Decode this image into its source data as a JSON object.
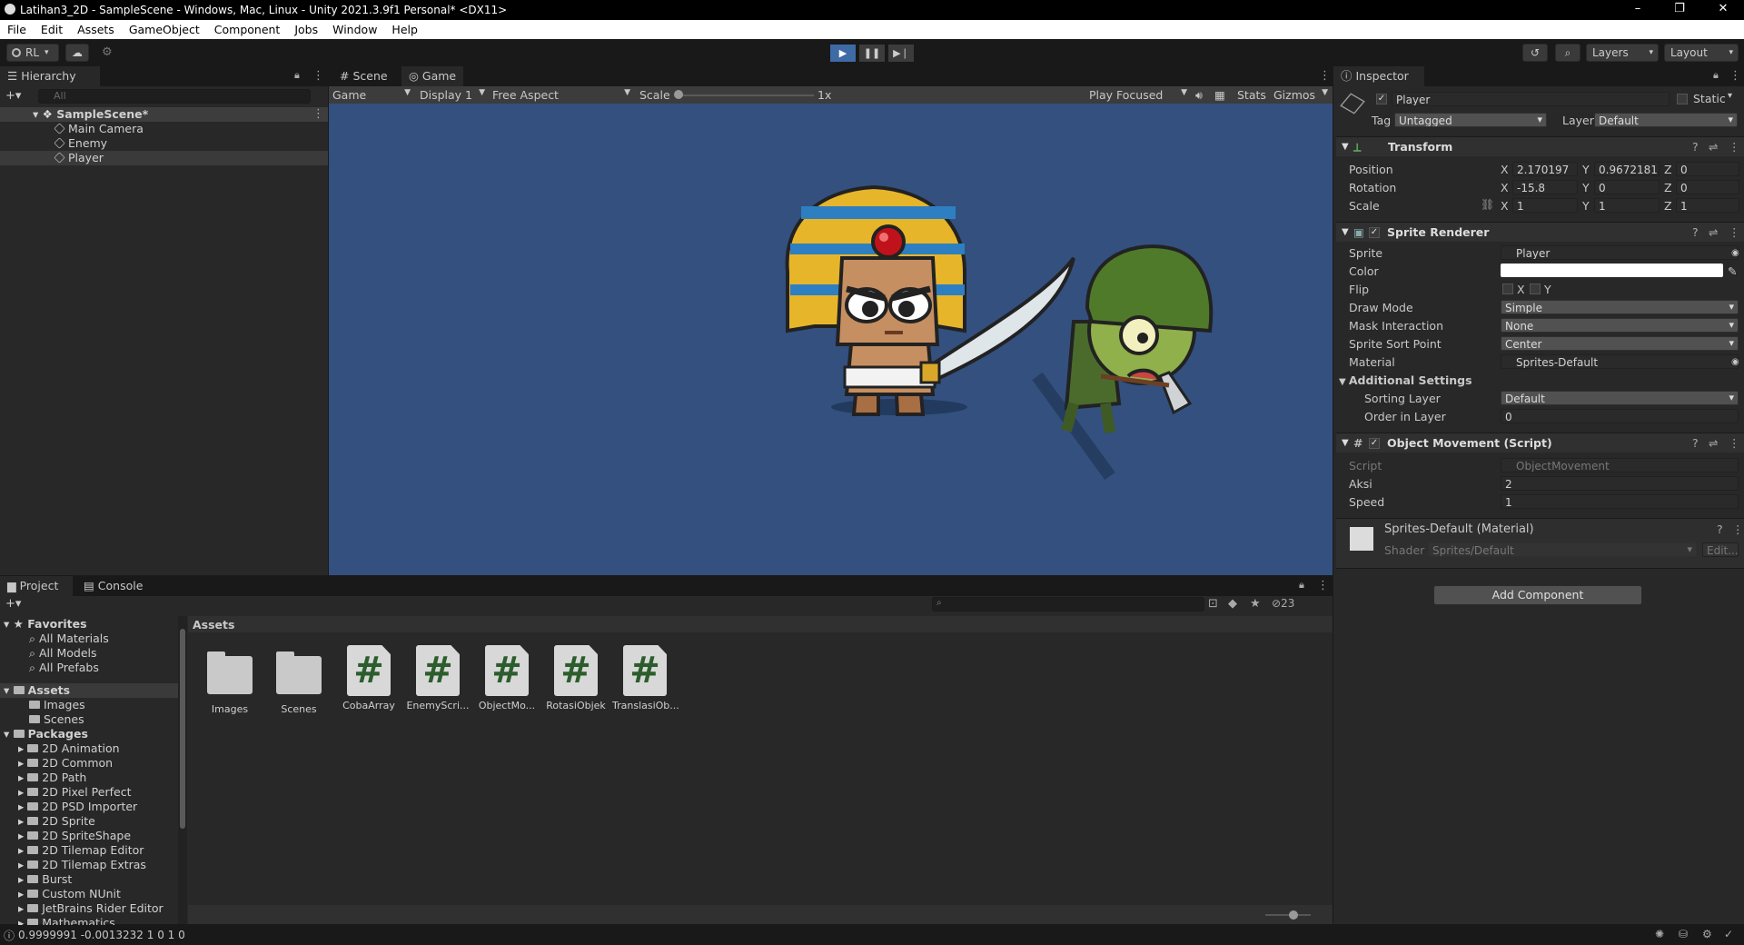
{
  "window": {
    "title": "Latihan3_2D - SampleScene - Windows, Mac, Linux - Unity 2021.3.9f1 Personal* <DX11>"
  },
  "menu": [
    "File",
    "Edit",
    "Assets",
    "GameObject",
    "Component",
    "Jobs",
    "Window",
    "Help"
  ],
  "toolbar": {
    "account": "RL",
    "layers": "Layers",
    "layout": "Layout"
  },
  "hierarchy": {
    "tab": "Hierarchy",
    "search_placeholder": "All",
    "scene": "SampleScene*",
    "items": [
      "Main Camera",
      "Enemy",
      "Player"
    ]
  },
  "viewport": {
    "tabs": [
      "Scene",
      "Game"
    ],
    "game_dropdown": "Game",
    "display": "Display 1",
    "aspect": "Free Aspect",
    "scale_label": "Scale",
    "scale_value": "1x",
    "play_focused": "Play Focused",
    "stats": "Stats",
    "gizmos": "Gizmos",
    "background": "#33507f"
  },
  "inspector": {
    "tab": "Inspector",
    "object_name": "Player",
    "static_label": "Static",
    "tag_label": "Tag",
    "tag_value": "Untagged",
    "layer_label": "Layer",
    "layer_value": "Default",
    "transform": {
      "header": "Transform",
      "position_label": "Position",
      "rotation_label": "Rotation",
      "scale_label": "Scale",
      "position": {
        "x": "2.170197",
        "y": "0.9672181",
        "z": "0"
      },
      "rotation": {
        "x": "-15.8",
        "y": "0",
        "z": "0"
      },
      "scale": {
        "x": "1",
        "y": "1",
        "z": "1"
      }
    },
    "sprite_renderer": {
      "header": "Sprite Renderer",
      "sprite_label": "Sprite",
      "sprite_value": "Player",
      "color_label": "Color",
      "flip_label": "Flip",
      "flip_x": "X",
      "flip_y": "Y",
      "draw_mode_label": "Draw Mode",
      "draw_mode_value": "Simple",
      "mask_label": "Mask Interaction",
      "mask_value": "None",
      "sort_point_label": "Sprite Sort Point",
      "sort_point_value": "Center",
      "material_label": "Material",
      "material_value": "Sprites-Default",
      "additional_label": "Additional Settings",
      "sorting_layer_label": "Sorting Layer",
      "sorting_layer_value": "Default",
      "order_label": "Order in Layer",
      "order_value": "0"
    },
    "object_movement": {
      "header": "Object Movement (Script)",
      "script_label": "Script",
      "script_value": "ObjectMovement",
      "aksi_label": "Aksi",
      "aksi_value": "2",
      "speed_label": "Speed",
      "speed_value": "1"
    },
    "material": {
      "name": "Sprites-Default (Material)",
      "shader_label": "Shader",
      "shader_value": "Sprites/Default",
      "edit": "Edit..."
    },
    "add_component": "Add Component"
  },
  "project": {
    "tabs": [
      "Project",
      "Console"
    ],
    "hidden_count": "23",
    "favorites_label": "Favorites",
    "favorites": [
      "All Materials",
      "All Models",
      "All Prefabs"
    ],
    "assets_label": "Assets",
    "asset_folders": [
      "Images",
      "Scenes"
    ],
    "packages_label": "Packages",
    "packages": [
      "2D Animation",
      "2D Common",
      "2D Path",
      "2D Pixel Perfect",
      "2D PSD Importer",
      "2D Sprite",
      "2D SpriteShape",
      "2D Tilemap Editor",
      "2D Tilemap Extras",
      "Burst",
      "Custom NUnit",
      "JetBrains Rider Editor",
      "Mathematics"
    ],
    "breadcrumb": "Assets",
    "grid": [
      {
        "name": "Images",
        "kind": "folder"
      },
      {
        "name": "Scenes",
        "kind": "folder"
      },
      {
        "name": "CobaArray",
        "kind": "script"
      },
      {
        "name": "EnemyScri...",
        "kind": "script"
      },
      {
        "name": "ObjectMo...",
        "kind": "script"
      },
      {
        "name": "RotasiObjek",
        "kind": "script"
      },
      {
        "name": "TranslasiOb...",
        "kind": "script"
      }
    ]
  },
  "statusbar": {
    "text": "0.9999991 -0.0013232 1 0 1 0"
  }
}
